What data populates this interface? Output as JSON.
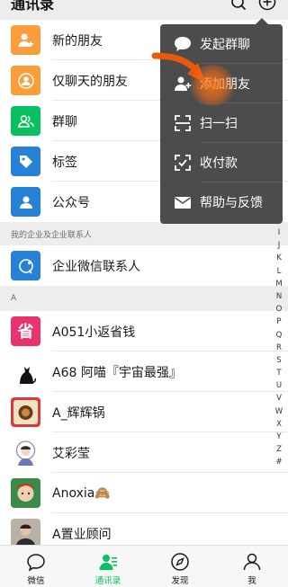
{
  "header": {
    "title": "通讯录",
    "search_icon": "search-icon",
    "add_icon": "plus-circle-icon"
  },
  "top_items": [
    {
      "label": "新的朋友",
      "icon": "add-friend-icon",
      "color": "#fa9d3b"
    },
    {
      "label": "仅聊天的朋友",
      "icon": "person-icon",
      "color": "#fa9d3b"
    },
    {
      "label": "群聊",
      "icon": "group-icon",
      "color": "#07c160"
    },
    {
      "label": "标签",
      "icon": "tag-icon",
      "color": "#2782d7"
    },
    {
      "label": "公众号",
      "icon": "person-icon",
      "color": "#2782d7"
    }
  ],
  "enterprise_section": {
    "header": "我的企业及企业联系人",
    "item": {
      "label": "企业微信联系人",
      "icon": "enterprise-chat-icon",
      "color": "#2782d7"
    }
  },
  "contacts_section": {
    "header": "A",
    "contacts": [
      {
        "name": "A051小返省钱"
      },
      {
        "name": "A68 阿喵『宇宙最强』"
      },
      {
        "name": "A_辉辉锅"
      },
      {
        "name": "艾彩莹"
      },
      {
        "name": "Anoxia🙈"
      },
      {
        "name": "A置业顾问"
      }
    ]
  },
  "index_letters": [
    "I",
    "J",
    "K",
    "L",
    "M",
    "N",
    "O",
    "P",
    "Q",
    "R",
    "S",
    "T",
    "U",
    "V",
    "W",
    "X",
    "Y",
    "Z",
    "#"
  ],
  "popup_menu": [
    {
      "label": "发起群聊",
      "icon": "chat-bubble-icon"
    },
    {
      "label": "添加朋友",
      "icon": "add-friend-icon"
    },
    {
      "label": "扫一扫",
      "icon": "scan-icon"
    },
    {
      "label": "收付款",
      "icon": "payment-icon"
    },
    {
      "label": "帮助与反馈",
      "icon": "mail-icon"
    }
  ],
  "tabbar": [
    {
      "label": "微信",
      "icon": "chat-icon",
      "active": false
    },
    {
      "label": "通讯录",
      "icon": "contacts-icon",
      "active": true
    },
    {
      "label": "发现",
      "icon": "compass-icon",
      "active": false
    },
    {
      "label": "我",
      "icon": "me-icon",
      "active": false
    }
  ],
  "colors": {
    "accent": "#07c160",
    "orange": "#fa9d3b",
    "blue": "#2782d7",
    "menu_bg": "#4c4c4c",
    "section_bg": "#ededed"
  }
}
